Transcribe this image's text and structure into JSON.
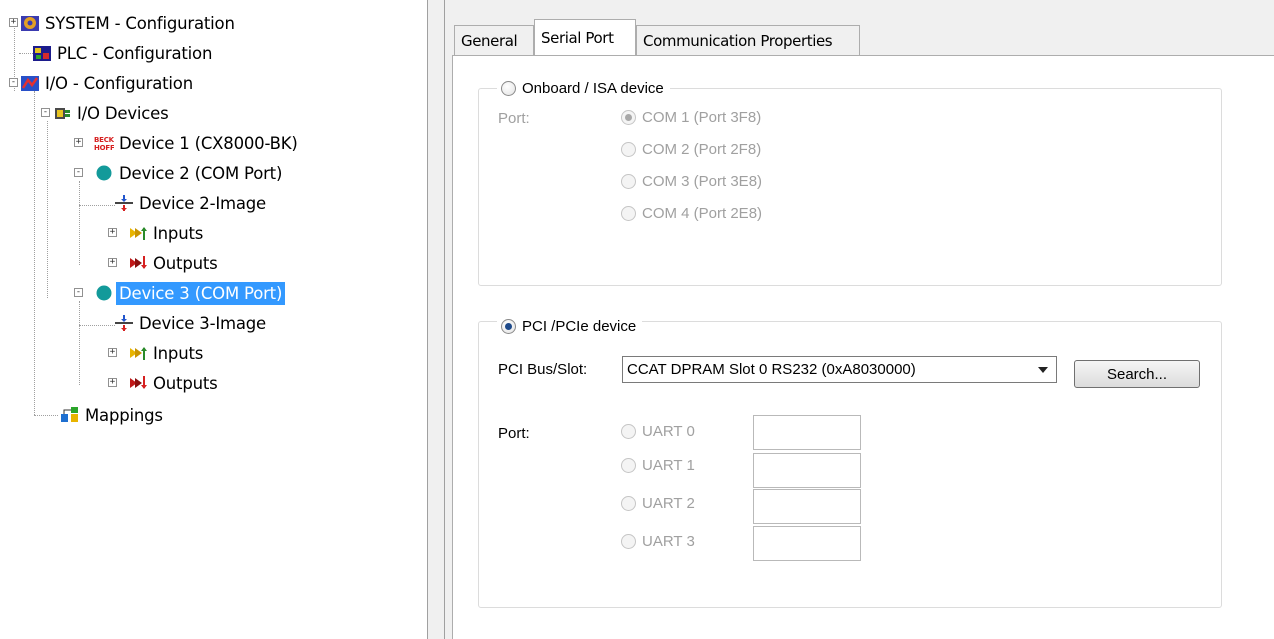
{
  "tree": {
    "items": [
      {
        "label": "SYSTEM - Configuration",
        "icon": "system-config-icon",
        "expander": "+"
      },
      {
        "label": "PLC - Configuration",
        "icon": "plc-config-icon",
        "expander": ""
      },
      {
        "label": "I/O - Configuration",
        "icon": "io-config-icon",
        "expander": "-"
      },
      {
        "label": "I/O Devices",
        "icon": "io-devices-icon",
        "expander": "-"
      },
      {
        "label": "Device 1 (CX8000-BK)",
        "icon": "beckhoff-logo-icon",
        "expander": "+",
        "icon_text": "BECK HOFF"
      },
      {
        "label": "Device 2 (COM Port)",
        "icon": "com-port-icon",
        "expander": "-"
      },
      {
        "label": "Device 2-Image",
        "icon": "device-image-icon",
        "expander": ""
      },
      {
        "label": "Inputs",
        "icon": "inputs-icon",
        "expander": "+"
      },
      {
        "label": "Outputs",
        "icon": "outputs-icon",
        "expander": "+"
      },
      {
        "label": "Device 3 (COM Port)",
        "icon": "com-port-icon",
        "expander": "-",
        "selected": true
      },
      {
        "label": "Device 3-Image",
        "icon": "device-image-icon",
        "expander": ""
      },
      {
        "label": "Inputs",
        "icon": "inputs-icon",
        "expander": "+"
      },
      {
        "label": "Outputs",
        "icon": "outputs-icon",
        "expander": "+"
      },
      {
        "label": "Mappings",
        "icon": "mappings-icon",
        "expander": ""
      }
    ]
  },
  "tabs": [
    {
      "label": "General",
      "active": false
    },
    {
      "label": "Serial Port",
      "active": true
    },
    {
      "label": "Communication Properties",
      "active": false
    }
  ],
  "onboard": {
    "legend": "Onboard / ISA device",
    "selected": false,
    "port_label": "Port:",
    "ports": [
      {
        "label": "COM 1 (Port 3F8)",
        "checked": true
      },
      {
        "label": "COM 2 (Port 2F8)",
        "checked": false
      },
      {
        "label": "COM 3 (Port 3E8)",
        "checked": false
      },
      {
        "label": "COM 4 (Port 2E8)",
        "checked": false
      }
    ]
  },
  "pci": {
    "legend": "PCI /PCIe device",
    "selected": true,
    "bus_slot_label": "PCI Bus/Slot:",
    "bus_slot_value": "CCAT DPRAM Slot 0 RS232 (0xA8030000)",
    "search_button": "Search...",
    "port_label": "Port:",
    "uarts": [
      {
        "label": "UART 0",
        "value": ""
      },
      {
        "label": "UART 1",
        "value": ""
      },
      {
        "label": "UART 2",
        "value": ""
      },
      {
        "label": "UART 3",
        "value": ""
      }
    ]
  },
  "colors": {
    "selection": "#3399ff",
    "disabled_text": "#a0a0a0",
    "com_port_dot": "#139a9a"
  }
}
